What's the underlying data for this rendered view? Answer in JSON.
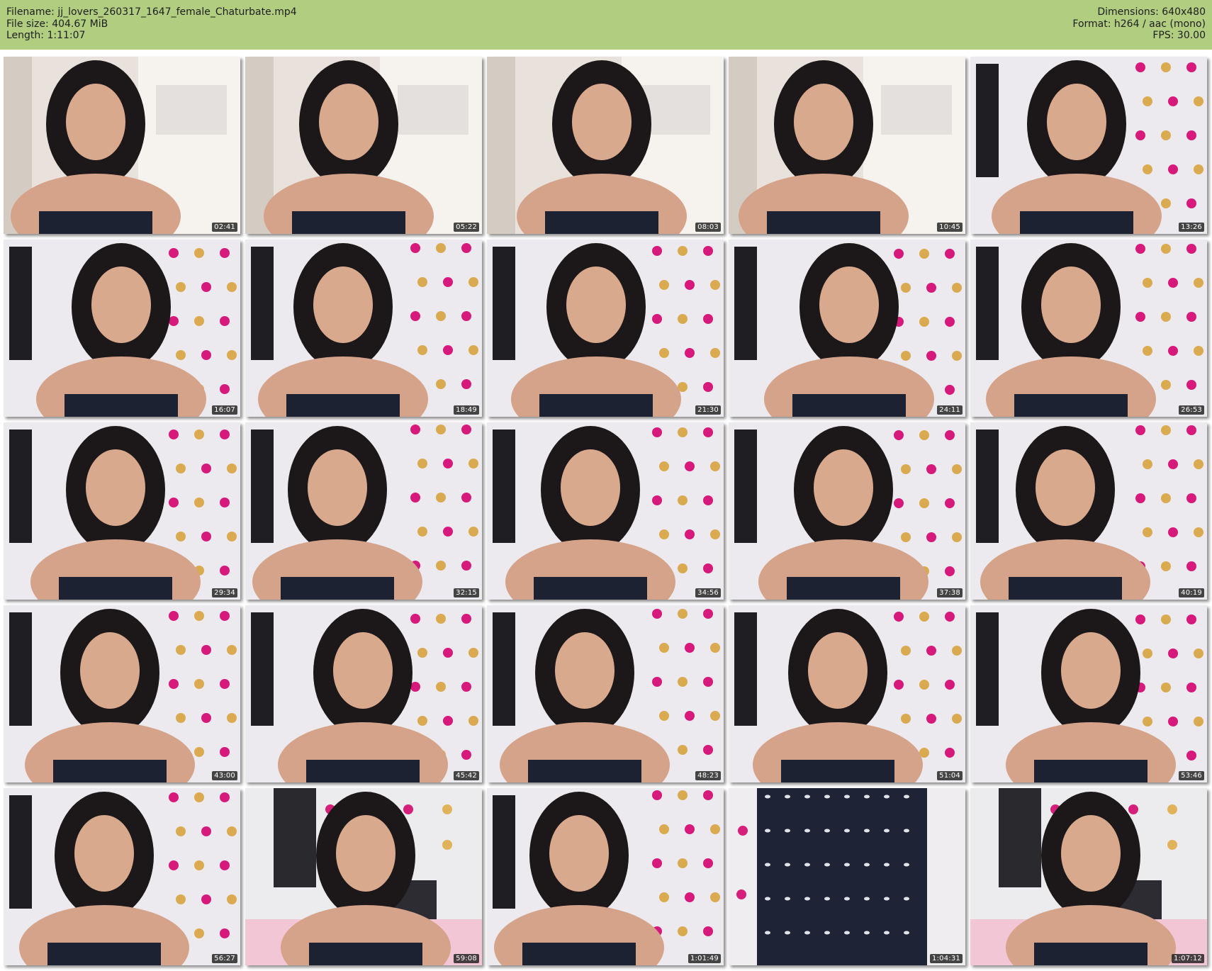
{
  "header": {
    "filename_label": "Filename:",
    "filename": "jj_lovers_260317_1647_female_Chaturbate.mp4",
    "filesize_label": "File size:",
    "filesize": "404.67 MiB",
    "length_label": "Length:",
    "length": "1:11:07",
    "dimensions_label": "Dimensions:",
    "dimensions": "640x480",
    "format_label": "Format:",
    "format": "h264 / aac (mono)",
    "fps_label": "FPS:",
    "fps": "30.00",
    "background_color": "#b1cd80"
  },
  "thumbnails": [
    {
      "time": "02:41",
      "scene": "window"
    },
    {
      "time": "05:22",
      "scene": "window"
    },
    {
      "time": "08:03",
      "scene": "window"
    },
    {
      "time": "10:45",
      "scene": "window"
    },
    {
      "time": "13:26",
      "scene": "dots"
    },
    {
      "time": "16:07",
      "scene": "dots"
    },
    {
      "time": "18:49",
      "scene": "dots"
    },
    {
      "time": "21:30",
      "scene": "dots"
    },
    {
      "time": "24:11",
      "scene": "dots"
    },
    {
      "time": "26:53",
      "scene": "dots"
    },
    {
      "time": "29:34",
      "scene": "dots"
    },
    {
      "time": "32:15",
      "scene": "dots"
    },
    {
      "time": "34:56",
      "scene": "dots"
    },
    {
      "time": "37:38",
      "scene": "dots"
    },
    {
      "time": "40:19",
      "scene": "dots"
    },
    {
      "time": "43:00",
      "scene": "dots"
    },
    {
      "time": "45:42",
      "scene": "dots"
    },
    {
      "time": "48:23",
      "scene": "dots"
    },
    {
      "time": "51:04",
      "scene": "dots"
    },
    {
      "time": "53:46",
      "scene": "dots"
    },
    {
      "time": "56:27",
      "scene": "dots"
    },
    {
      "time": "59:08",
      "scene": "room"
    },
    {
      "time": "1:01:49",
      "scene": "dots"
    },
    {
      "time": "1:04:31",
      "scene": "dress"
    },
    {
      "time": "1:07:12",
      "scene": "room"
    }
  ]
}
